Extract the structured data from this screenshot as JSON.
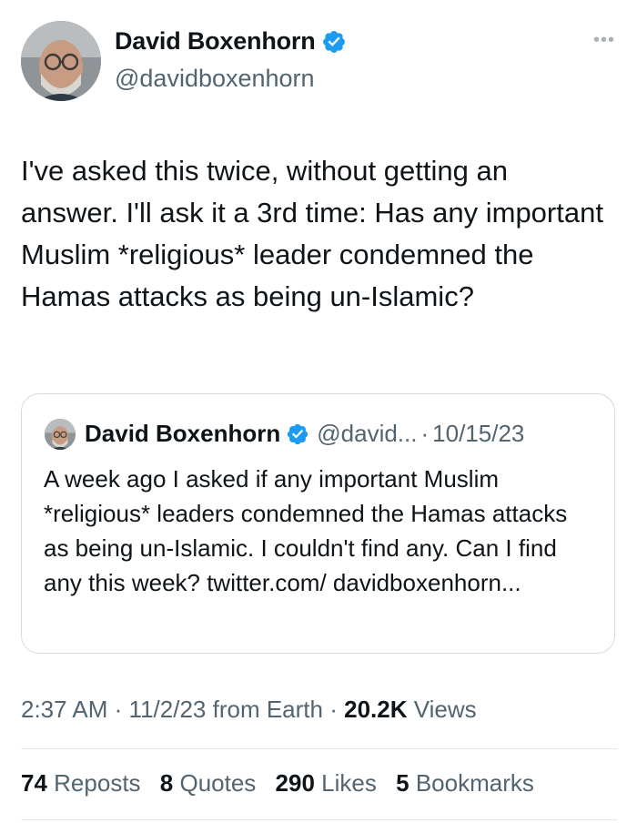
{
  "author": {
    "name": "David Boxenhorn",
    "handle": "@davidboxenhorn",
    "verified": true
  },
  "more_icon": "more-icon",
  "tweet": {
    "text": "I've asked this twice, without getting an answer. I'll ask it a 3rd time: Has any important Muslim *religious* leader condemned the Hamas attacks as being un-Islamic?"
  },
  "quoted_tweet": {
    "name": "David Boxenhorn",
    "handle": "@david...",
    "separator": "·",
    "date": "10/15/23",
    "text": "A week ago I asked if any important Muslim *religious* leaders condemned the Hamas attacks as being un-Islamic. I couldn't find any. Can I find any this week? twitter.com/ davidboxenhorn..."
  },
  "meta": {
    "time": "2:37 AM",
    "sep1": "·",
    "date": "11/2/23",
    "source": "from Earth",
    "sep2": "·",
    "views_count": "20.2K",
    "views_label": "Views"
  },
  "stats": {
    "reposts_count": "74",
    "reposts_label": "Reposts",
    "quotes_count": "8",
    "quotes_label": "Quotes",
    "likes_count": "290",
    "likes_label": "Likes",
    "bookmarks_count": "5",
    "bookmarks_label": "Bookmarks"
  },
  "colors": {
    "verified_blue": "#1d9bf0",
    "secondary_text": "#536471",
    "primary_text": "#0f1419",
    "border": "#d4dbe0"
  }
}
